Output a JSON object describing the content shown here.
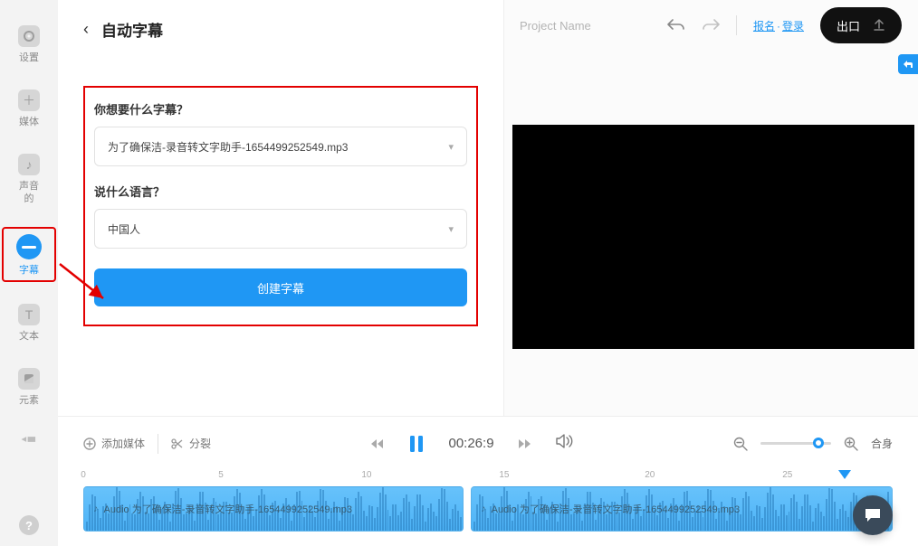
{
  "sidebar": {
    "items": [
      {
        "label": "设置",
        "icon": "gear-icon"
      },
      {
        "label": "媒体",
        "icon": "plus-icon"
      },
      {
        "label": "声音\n的",
        "icon": "note-icon"
      },
      {
        "label": "字幕",
        "icon": "subtitle-icon"
      },
      {
        "label": "文本",
        "icon": "text-icon"
      },
      {
        "label": "元素",
        "icon": "elements-icon"
      }
    ],
    "help_glyph": "?"
  },
  "panel": {
    "title": "自动字幕",
    "q1": "你想要什么字幕？",
    "file_value": "为了确保洁-录音转文字助手-1654499252549.mp3",
    "q2": "说什么语言？",
    "lang_value": "中国人",
    "create_label": "创建字幕"
  },
  "topbar": {
    "project_name": "Project Name",
    "signup": "报名",
    "login": "登录",
    "export": "出口"
  },
  "timeline": {
    "add_media": "添加媒体",
    "split": "分裂",
    "time": "00:26:9",
    "fit": "合身",
    "ruler": [
      "0",
      "5",
      "10",
      "15",
      "20",
      "25"
    ],
    "clip_label": "Audio 为了确保洁-录音转文字助手-1654499252549.mp3",
    "clip_label2": "Audio 为了确保洁-录音转文字助手-1654499252549.mp3"
  },
  "colors": {
    "accent": "#1f97f4",
    "annotation": "#e30000",
    "export_bg": "#111111"
  }
}
